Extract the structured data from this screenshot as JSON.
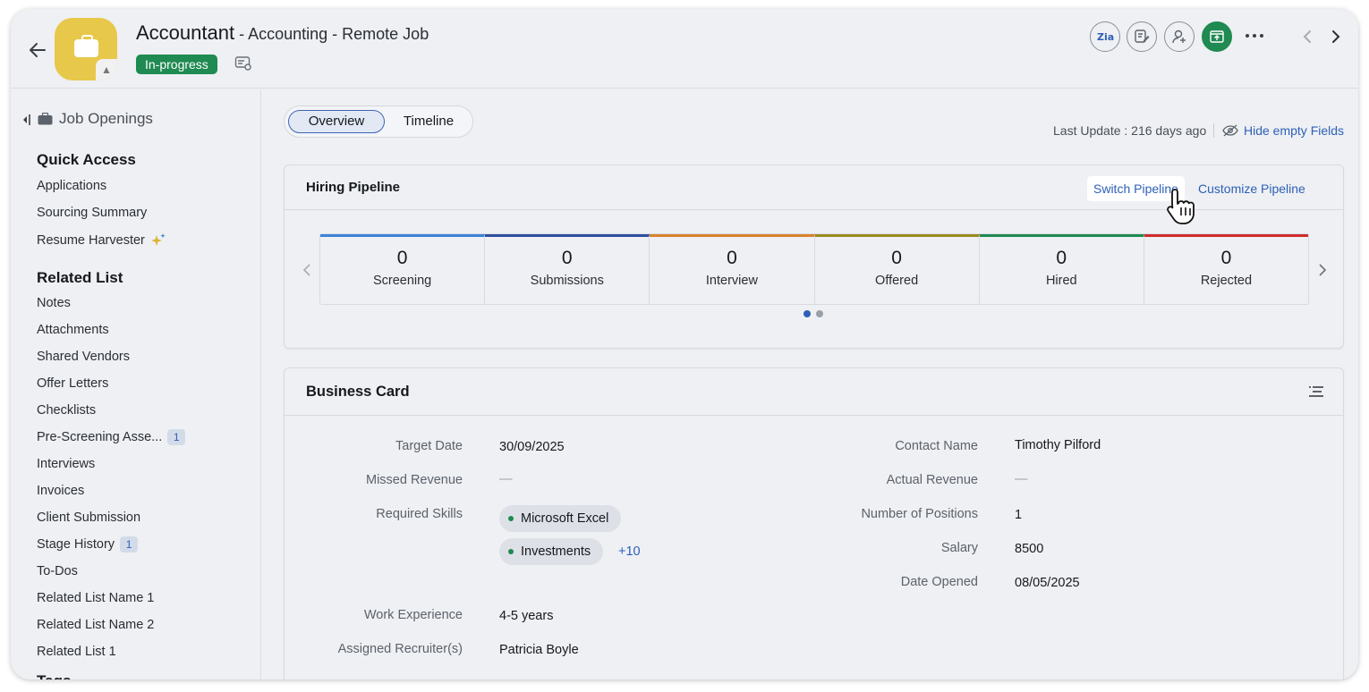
{
  "header": {
    "title": "Accountant",
    "subtitle_department": "Accounting",
    "subtitle_type": "Remote Job",
    "separator": " - ",
    "status": "In-progress",
    "status_color": "#1f8a52"
  },
  "sidebar": {
    "root_label": "Job Openings",
    "quick_access_title": "Quick Access",
    "quick_access": [
      {
        "label": "Applications"
      },
      {
        "label": "Sourcing Summary"
      },
      {
        "label": "Resume Harvester"
      }
    ],
    "related_list_title": "Related List",
    "related_list": [
      {
        "label": "Notes"
      },
      {
        "label": "Attachments"
      },
      {
        "label": "Shared Vendors"
      },
      {
        "label": "Offer Letters"
      },
      {
        "label": "Checklists"
      },
      {
        "label": "Pre-Screening Asse...",
        "badge": "1"
      },
      {
        "label": "Interviews"
      },
      {
        "label": "Invoices"
      },
      {
        "label": "Client Submission"
      },
      {
        "label": "Stage History",
        "badge": "1"
      },
      {
        "label": "To-Dos"
      },
      {
        "label": "Related List Name 1"
      },
      {
        "label": "Related List Name 2"
      },
      {
        "label": "Related List 1"
      }
    ],
    "tags_title": "Tags"
  },
  "main": {
    "tabs": [
      {
        "label": "Overview"
      },
      {
        "label": "Timeline"
      }
    ],
    "last_update": "Last Update : 216 days ago",
    "hide_empty": "Hide empty Fields",
    "pipeline": {
      "title": "Hiring Pipeline",
      "switch_label": "Switch Pipeline",
      "customize_label": "Customize Pipeline",
      "stages": [
        {
          "count": "0",
          "label": "Screening",
          "color": "#3b82d6"
        },
        {
          "count": "0",
          "label": "Submissions",
          "color": "#2f4fa0"
        },
        {
          "count": "0",
          "label": "Interview",
          "color": "#d9822b"
        },
        {
          "count": "0",
          "label": "Offered",
          "color": "#9a8b1e"
        },
        {
          "count": "0",
          "label": "Hired",
          "color": "#1f8a52"
        },
        {
          "count": "0",
          "label": "Rejected",
          "color": "#d12b2b"
        }
      ]
    },
    "business_card": {
      "title": "Business Card",
      "left": {
        "target_date_label": "Target Date",
        "target_date": "30/09/2025",
        "missed_revenue_label": "Missed Revenue",
        "missed_revenue": "—",
        "required_skills_label": "Required Skills",
        "skills": [
          "Microsoft Excel",
          "Investments"
        ],
        "skills_more": "+10",
        "work_experience_label": "Work Experience",
        "work_experience": "4-5 years",
        "assigned_recruiter_label": "Assigned Recruiter(s)",
        "assigned_recruiter": "Patricia Boyle"
      },
      "right": {
        "contact_name_label": "Contact Name",
        "contact_name": "Timothy Pilford",
        "actual_revenue_label": "Actual Revenue",
        "actual_revenue": "—",
        "positions_label": "Number of Positions",
        "positions": "1",
        "salary_label": "Salary",
        "salary": "8500",
        "date_opened_label": "Date Opened",
        "date_opened": "08/05/2025"
      }
    }
  }
}
